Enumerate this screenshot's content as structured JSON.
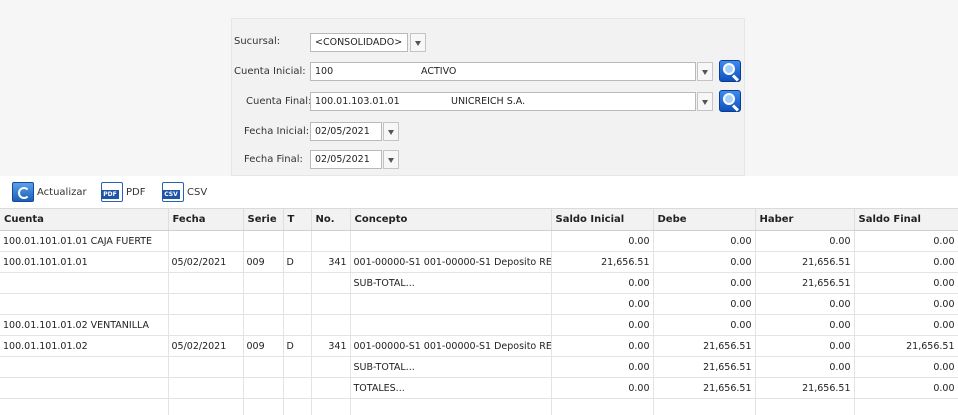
{
  "filters": {
    "sucursal": {
      "label": "Sucursal:",
      "value": "<CONSOLIDADO>"
    },
    "cuenta_inicial": {
      "label": "Cuenta Inicial:",
      "code": "100",
      "name": "ACTIVO"
    },
    "cuenta_final": {
      "label": "Cuenta Final:",
      "code": "100.01.103.01.01",
      "name": "UNICREICH S.A."
    },
    "fecha_inicial": {
      "label": "Fecha Inicial:",
      "value": "02/05/2021"
    },
    "fecha_final": {
      "label": "Fecha Final:",
      "value": "02/05/2021"
    }
  },
  "toolbar": {
    "actualizar": "Actualizar",
    "pdf": "PDF",
    "pdf_icon_tag": "PDF",
    "csv": "CSV",
    "csv_icon_tag": "CSV"
  },
  "table": {
    "headers": [
      "Cuenta",
      "Fecha",
      "Serie",
      "T",
      "No.",
      "Concepto",
      "Saldo Inicial",
      "Debe",
      "Haber",
      "Saldo Final"
    ],
    "rows": [
      [
        "100.01.101.01.01 CAJA FUERTE",
        "",
        "",
        "",
        "",
        "",
        "0.00",
        "0.00",
        "0.00",
        "0.00"
      ],
      [
        "100.01.101.01.01",
        "05/02/2021",
        "009",
        "D",
        "341",
        "001-00000-S1 001-00000-S1 Deposito RE",
        "21,656.51",
        "0.00",
        "21,656.51",
        "0.00"
      ],
      [
        "",
        "",
        "",
        "",
        "",
        "SUB-TOTAL...",
        "0.00",
        "0.00",
        "21,656.51",
        "0.00"
      ],
      [
        "",
        "",
        "",
        "",
        "",
        "",
        "0.00",
        "0.00",
        "0.00",
        "0.00"
      ],
      [
        "100.01.101.01.02 VENTANILLA",
        "",
        "",
        "",
        "",
        "",
        "0.00",
        "0.00",
        "0.00",
        "0.00"
      ],
      [
        "100.01.101.01.02",
        "05/02/2021",
        "009",
        "D",
        "341",
        "001-00000-S1 001-00000-S1 Deposito RE",
        "0.00",
        "21,656.51",
        "0.00",
        "21,656.51"
      ],
      [
        "",
        "",
        "",
        "",
        "",
        "SUB-TOTAL...",
        "0.00",
        "21,656.51",
        "0.00",
        "0.00"
      ],
      [
        "",
        "",
        "",
        "",
        "",
        "TOTALES...",
        "0.00",
        "21,656.51",
        "21,656.51",
        "0.00"
      ],
      [
        "",
        "",
        "",
        "",
        "",
        "",
        "",
        "",
        "",
        ""
      ]
    ]
  }
}
